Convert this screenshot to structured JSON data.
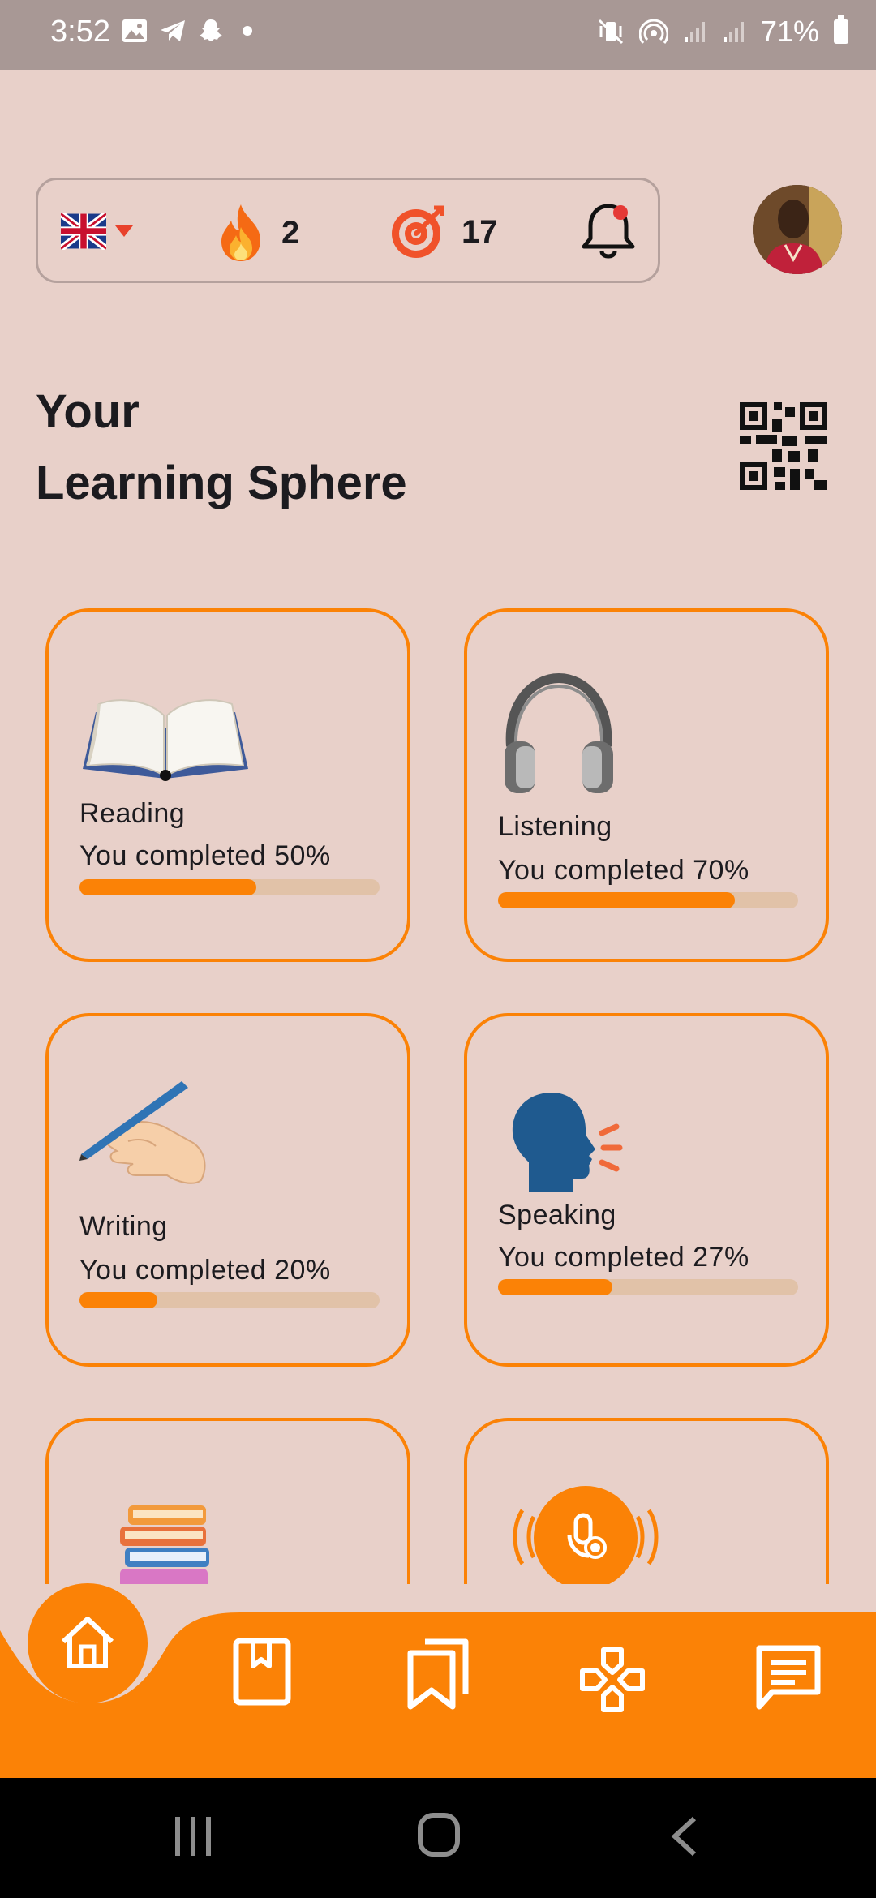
{
  "status_bar": {
    "time": "3:52",
    "battery": "71%",
    "left_icons": [
      "gallery-icon",
      "telegram-icon",
      "snapchat-icon",
      "dot-icon"
    ],
    "right_icons": [
      "mute-vibrate-icon",
      "hotspot-icon",
      "signal-icon",
      "signal-icon",
      "battery-icon"
    ]
  },
  "header": {
    "language_flag": "uk-flag-icon",
    "streak_count": "2",
    "target_count": "17",
    "has_notification": true
  },
  "page": {
    "title_line1": "Your",
    "title_line2": "Learning Sphere"
  },
  "cards": [
    {
      "name": "Reading",
      "progress_text": "You completed 50%",
      "progress": 0.59,
      "icon": "open-book-icon"
    },
    {
      "name": "Listening",
      "progress_text": "You completed 70%",
      "progress": 0.79,
      "icon": "headphones-icon"
    },
    {
      "name": "Writing",
      "progress_text": "You completed 20%",
      "progress": 0.26,
      "icon": "writing-hand-icon"
    },
    {
      "name": "Speaking",
      "progress_text": "You completed 27%",
      "progress": 0.38,
      "icon": "speaking-head-icon"
    }
  ],
  "partial_cards": [
    {
      "icon": "books-stack-icon"
    },
    {
      "icon": "voice-record-icon"
    }
  ],
  "bottom_nav": {
    "items": [
      "home-icon",
      "book-icon",
      "bookmarks-icon",
      "games-icon",
      "chat-icon"
    ],
    "active": "home-icon"
  },
  "colors": {
    "background": "#e8d0c9",
    "accent": "#fb8206",
    "track": "#e1c2a8",
    "status_bar": "#a89895"
  }
}
